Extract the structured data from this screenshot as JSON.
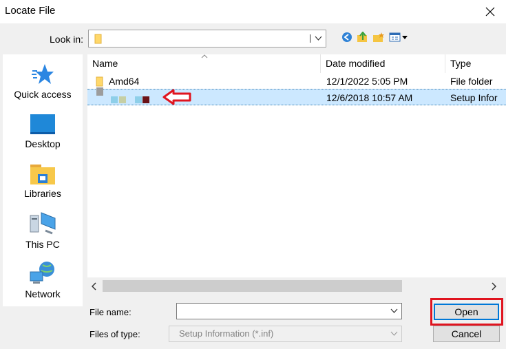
{
  "window": {
    "title": "Locate File"
  },
  "toolbar": {
    "look_in_label": "Look in:",
    "look_in_value": ""
  },
  "places": [
    {
      "label": "Quick access",
      "icon": "star-icon"
    },
    {
      "label": "Desktop",
      "icon": "desktop-icon"
    },
    {
      "label": "Libraries",
      "icon": "libraries-icon"
    },
    {
      "label": "This PC",
      "icon": "computer-icon"
    },
    {
      "label": "Network",
      "icon": "network-icon"
    }
  ],
  "columns": [
    "Name",
    "Date modified",
    "Type"
  ],
  "files": [
    {
      "name": "Amd64",
      "date": "12/1/2022 5:05 PM",
      "type": "File folder",
      "selected": false
    },
    {
      "name": "",
      "date": "12/6/2018 10:57 AM",
      "type": "Setup Infor",
      "selected": true
    }
  ],
  "form": {
    "file_name_label": "File name:",
    "file_name_value": "",
    "files_of_type_label": "Files of type:",
    "files_of_type_value": "Setup Information (*.inf)"
  },
  "buttons": {
    "open": "Open",
    "cancel": "Cancel"
  },
  "colors": {
    "highlight": "#e0141f",
    "selection": "#cce8ff",
    "accent": "#0078d7"
  }
}
